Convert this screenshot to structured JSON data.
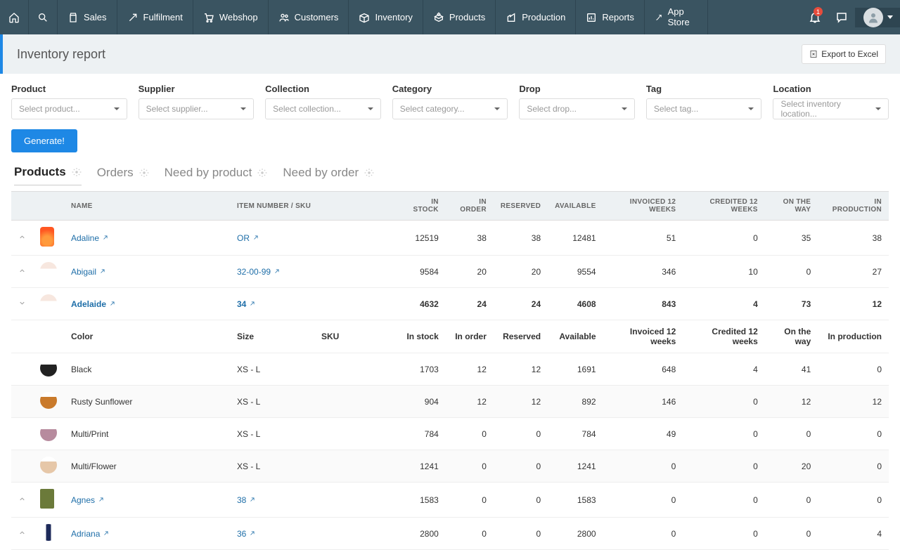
{
  "nav": {
    "items": [
      "Sales",
      "Fulfilment",
      "Webshop",
      "Customers",
      "Inventory",
      "Products",
      "Production",
      "Reports",
      "App Store"
    ],
    "notif_count": "1"
  },
  "page": {
    "title": "Inventory report",
    "export": "Export to Excel"
  },
  "filters": {
    "labels": [
      "Product",
      "Supplier",
      "Collection",
      "Category",
      "Drop",
      "Tag",
      "Location"
    ],
    "placeholders": [
      "Select product...",
      "Select supplier...",
      "Select collection...",
      "Select category...",
      "Select drop...",
      "Select tag...",
      "Select inventory location..."
    ],
    "generate": "Generate!"
  },
  "tabs": [
    "Products",
    "Orders",
    "Need by product",
    "Need by order"
  ],
  "table": {
    "headers": [
      "NAME",
      "ITEM NUMBER / SKU",
      "IN STOCK",
      "IN ORDER",
      "RESERVED",
      "AVAILABLE",
      "INVOICED 12 WEEKS",
      "CREDITED 12 WEEKS",
      "ON THE WAY",
      "IN PRODUCTION"
    ],
    "sub_headers": [
      "Color",
      "Size",
      "SKU",
      "In stock",
      "In order",
      "Reserved",
      "Available",
      "Invoiced 12 weeks",
      "Credited 12 weeks",
      "On the way",
      "In production"
    ],
    "rows": [
      {
        "name": "Adaline",
        "sku": "OR",
        "in_stock": "12519",
        "in_order": "38",
        "reserved": "38",
        "available": "12481",
        "invoiced": "51",
        "credited": "0",
        "on_way": "35",
        "in_prod": "38"
      },
      {
        "name": "Abigail",
        "sku": "32-00-99",
        "in_stock": "9584",
        "in_order": "20",
        "reserved": "20",
        "available": "9554",
        "invoiced": "346",
        "credited": "10",
        "on_way": "0",
        "in_prod": "27"
      },
      {
        "name": "Adelaide",
        "sku": "34",
        "in_stock": "4632",
        "in_order": "24",
        "reserved": "24",
        "available": "4608",
        "invoiced": "843",
        "credited": "4",
        "on_way": "73",
        "in_prod": "12",
        "expanded": true
      },
      {
        "name": "Agnes",
        "sku": "38",
        "in_stock": "1583",
        "in_order": "0",
        "reserved": "0",
        "available": "1583",
        "invoiced": "0",
        "credited": "0",
        "on_way": "0",
        "in_prod": "0"
      },
      {
        "name": "Adriana",
        "sku": "36",
        "in_stock": "2800",
        "in_order": "0",
        "reserved": "0",
        "available": "2800",
        "invoiced": "0",
        "credited": "0",
        "on_way": "0",
        "in_prod": "4"
      }
    ],
    "variants": [
      {
        "color": "Black",
        "size": "XS - L",
        "sku": "",
        "in_stock": "1703",
        "in_order": "12",
        "reserved": "12",
        "available": "1691",
        "invoiced": "648",
        "credited": "4",
        "on_way": "41",
        "in_prod": "0"
      },
      {
        "color": "Rusty Sunflower",
        "size": "XS - L",
        "sku": "",
        "in_stock": "904",
        "in_order": "12",
        "reserved": "12",
        "available": "892",
        "invoiced": "146",
        "credited": "0",
        "on_way": "12",
        "in_prod": "12"
      },
      {
        "color": "Multi/Print",
        "size": "XS - L",
        "sku": "",
        "in_stock": "784",
        "in_order": "0",
        "reserved": "0",
        "available": "784",
        "invoiced": "49",
        "credited": "0",
        "on_way": "0",
        "in_prod": "0"
      },
      {
        "color": "Multi/Flower",
        "size": "XS - L",
        "sku": "",
        "in_stock": "1241",
        "in_order": "0",
        "reserved": "0",
        "available": "1241",
        "invoiced": "0",
        "credited": "0",
        "on_way": "20",
        "in_prod": "0"
      }
    ]
  }
}
